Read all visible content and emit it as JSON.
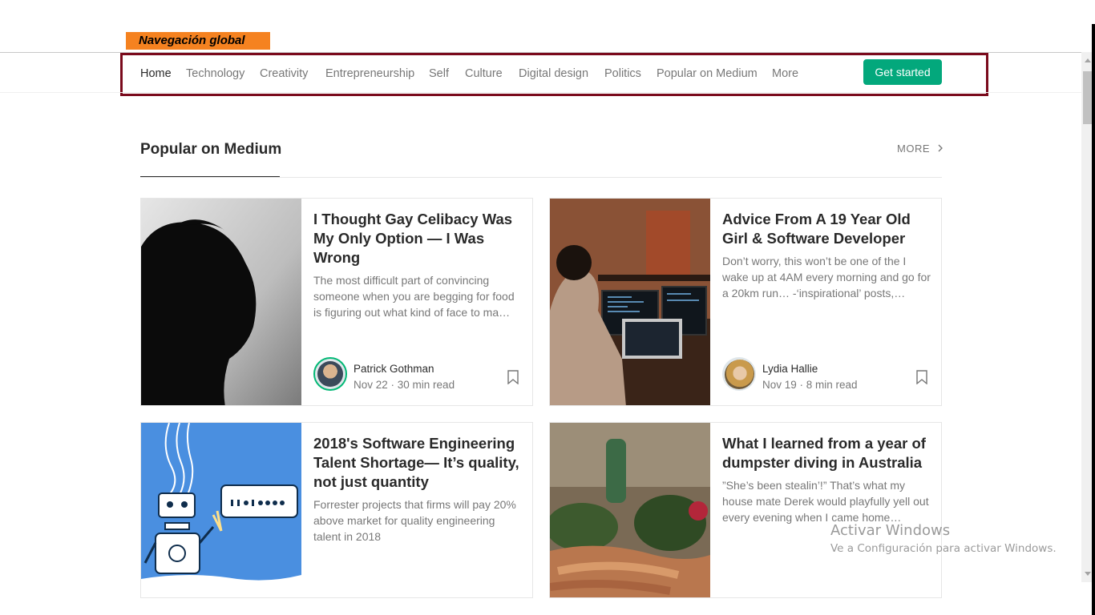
{
  "annotation": {
    "label": "Navegación global"
  },
  "nav": {
    "items": [
      {
        "label": "Home",
        "active": true
      },
      {
        "label": "Technology"
      },
      {
        "label": "Creativity"
      },
      {
        "label": "Entrepreneurship"
      },
      {
        "label": "Self"
      },
      {
        "label": "Culture"
      },
      {
        "label": "Digital design"
      },
      {
        "label": "Politics"
      },
      {
        "label": "Popular on Medium"
      },
      {
        "label": "More"
      }
    ],
    "cta_label": "Get started",
    "accent_color": "#03a87c",
    "highlight_border_color": "#7a0a1c"
  },
  "section": {
    "title": "Popular on Medium",
    "more_label": "MORE",
    "more_icon": "chevron-right-icon"
  },
  "cards": [
    {
      "title": "I Thought Gay Celibacy Was My Only Option — I Was Wrong",
      "excerpt": "The most difficult part of convincing someone when you are begging for food is figuring out what kind of face to ma…",
      "author": "Patrick Gothman",
      "date": "Nov 22",
      "read_time": "30 min read",
      "bookmark_icon": "bookmark-icon"
    },
    {
      "title": "Advice From A 19 Year Old Girl & Software Developer",
      "excerpt": "Don’t worry, this won’t be one of the I wake up at 4AM every morning and go for a 20km run… -‘inspirational’ posts,…",
      "author": "Lydia Hallie",
      "date": "Nov 19",
      "read_time": "8 min read",
      "bookmark_icon": "bookmark-icon"
    },
    {
      "title": "2018's Software Engineering Talent Shortage— It’s quality, not just quantity",
      "excerpt": "Forrester projects that firms will pay 20% above market for quality engineering talent in 2018"
    },
    {
      "title": "What I learned from a year of dumpster diving in Australia",
      "excerpt": "”She’s been stealin’!” That’s what my house mate Derek would playfully yell out every evening when I came home…"
    }
  ],
  "watermark": {
    "line1": "Activar Windows",
    "line2": "Ve a Configuración para activar Windows."
  }
}
